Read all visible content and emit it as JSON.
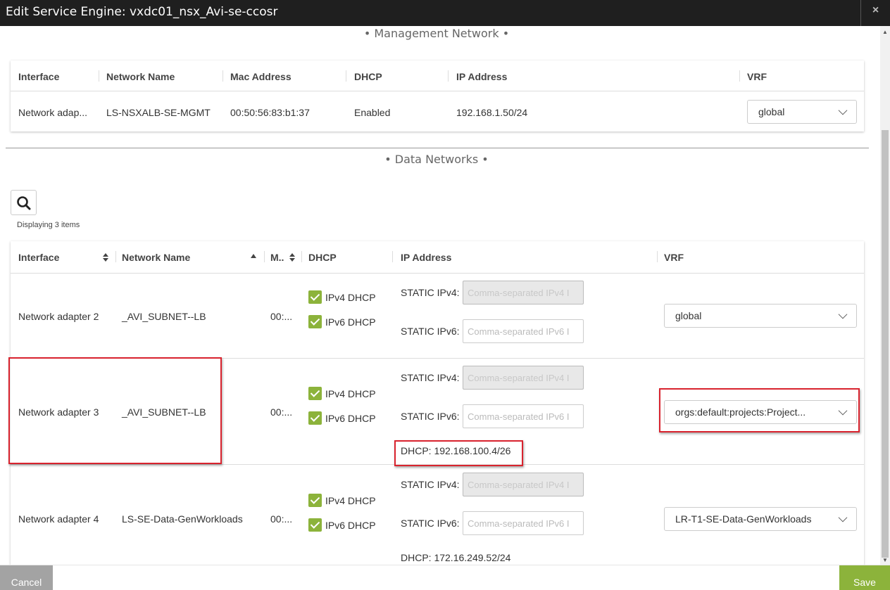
{
  "window": {
    "title": "Edit Service Engine: vxdc01_nsx_Avi-se-ccosr",
    "close_label": "×"
  },
  "management": {
    "section_title": "• Management Network •",
    "headers": [
      "Interface",
      "Network Name",
      "Mac Address",
      "DHCP",
      "IP Address",
      "VRF"
    ],
    "row": {
      "interface": "Network adap...",
      "network": "LS-NSXALB-SE-MGMT",
      "mac": "00:50:56:83:b1:37",
      "dhcp": "Enabled",
      "ip": "192.168.1.50/24",
      "vrf": "global"
    }
  },
  "data_networks": {
    "section_title": "• Data Networks •",
    "displaying": "Displaying 3 items",
    "headers": {
      "interface": "Interface",
      "network": "Network Name",
      "mac": "M..",
      "dhcp": "DHCP",
      "ip": "IP Address",
      "vrf": "VRF"
    },
    "ipv4_dhcp_label": "IPv4 DHCP",
    "ipv6_dhcp_label": "IPv6 DHCP",
    "static_ipv4_label": "STATIC IPv4:",
    "static_ipv6_label": "STATIC IPv6:",
    "ipv4_placeholder": "Comma-separated IPv4 I",
    "ipv6_placeholder": "Comma-separated IPv6 I",
    "rows": [
      {
        "interface": "Network adapter 2",
        "network": "_AVI_SUBNET--LB",
        "mac": "00:...",
        "ipv4_checked": true,
        "ipv6_checked": true,
        "dhcp_ip": "",
        "vrf": "global"
      },
      {
        "interface": "Network adapter 3",
        "network": "_AVI_SUBNET--LB",
        "mac": "00:...",
        "ipv4_checked": true,
        "ipv6_checked": true,
        "dhcp_ip": "DHCP: 192.168.100.4/26",
        "vrf": "orgs:default:projects:Project..."
      },
      {
        "interface": "Network adapter 4",
        "network": "LS-SE-Data-GenWorkloads",
        "mac": "00:...",
        "ipv4_checked": true,
        "ipv6_checked": true,
        "dhcp_ip": "DHCP: 172.16.249.52/24",
        "vrf": "LR-T1-SE-Data-GenWorkloads"
      }
    ]
  },
  "footer": {
    "cancel_label": "Cancel",
    "save_label": "Save"
  },
  "colors": {
    "titlebar": "#1f1f1f",
    "accent_green": "#8cb33b",
    "cancel_gray": "#a3a3a3",
    "highlight_red": "#d9232e"
  }
}
